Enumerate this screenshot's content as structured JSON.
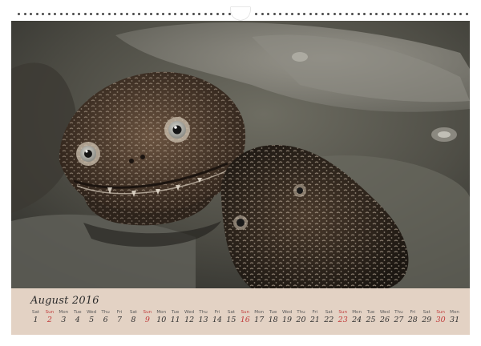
{
  "calendar": {
    "month_label": "August 2016",
    "colors": {
      "footer_bg": "#e3d2c4",
      "sunday": "#c13b3b",
      "text": "#333333"
    },
    "days": [
      {
        "wd": "Sat",
        "dn": "1",
        "sunday": false
      },
      {
        "wd": "Sun",
        "dn": "2",
        "sunday": true
      },
      {
        "wd": "Mon",
        "dn": "3",
        "sunday": false
      },
      {
        "wd": "Tue",
        "dn": "4",
        "sunday": false
      },
      {
        "wd": "Wed",
        "dn": "5",
        "sunday": false
      },
      {
        "wd": "Thu",
        "dn": "6",
        "sunday": false
      },
      {
        "wd": "Fri",
        "dn": "7",
        "sunday": false
      },
      {
        "wd": "Sat",
        "dn": "8",
        "sunday": false
      },
      {
        "wd": "Sun",
        "dn": "9",
        "sunday": true
      },
      {
        "wd": "Mon",
        "dn": "10",
        "sunday": false
      },
      {
        "wd": "Tue",
        "dn": "11",
        "sunday": false
      },
      {
        "wd": "Wed",
        "dn": "12",
        "sunday": false
      },
      {
        "wd": "Thu",
        "dn": "13",
        "sunday": false
      },
      {
        "wd": "Fri",
        "dn": "14",
        "sunday": false
      },
      {
        "wd": "Sat",
        "dn": "15",
        "sunday": false
      },
      {
        "wd": "Sun",
        "dn": "16",
        "sunday": true
      },
      {
        "wd": "Mon",
        "dn": "17",
        "sunday": false
      },
      {
        "wd": "Tue",
        "dn": "18",
        "sunday": false
      },
      {
        "wd": "Wed",
        "dn": "19",
        "sunday": false
      },
      {
        "wd": "Thu",
        "dn": "20",
        "sunday": false
      },
      {
        "wd": "Fri",
        "dn": "21",
        "sunday": false
      },
      {
        "wd": "Sat",
        "dn": "22",
        "sunday": false
      },
      {
        "wd": "Sun",
        "dn": "23",
        "sunday": true
      },
      {
        "wd": "Mon",
        "dn": "24",
        "sunday": false
      },
      {
        "wd": "Tue",
        "dn": "25",
        "sunday": false
      },
      {
        "wd": "Wed",
        "dn": "26",
        "sunday": false
      },
      {
        "wd": "Thu",
        "dn": "27",
        "sunday": false
      },
      {
        "wd": "Fri",
        "dn": "28",
        "sunday": false
      },
      {
        "wd": "Sat",
        "dn": "29",
        "sunday": false
      },
      {
        "wd": "Sun",
        "dn": "30",
        "sunday": true
      },
      {
        "wd": "Mon",
        "dn": "31",
        "sunday": false
      }
    ]
  },
  "photo": {
    "subject_icon": "salamander-photo"
  }
}
